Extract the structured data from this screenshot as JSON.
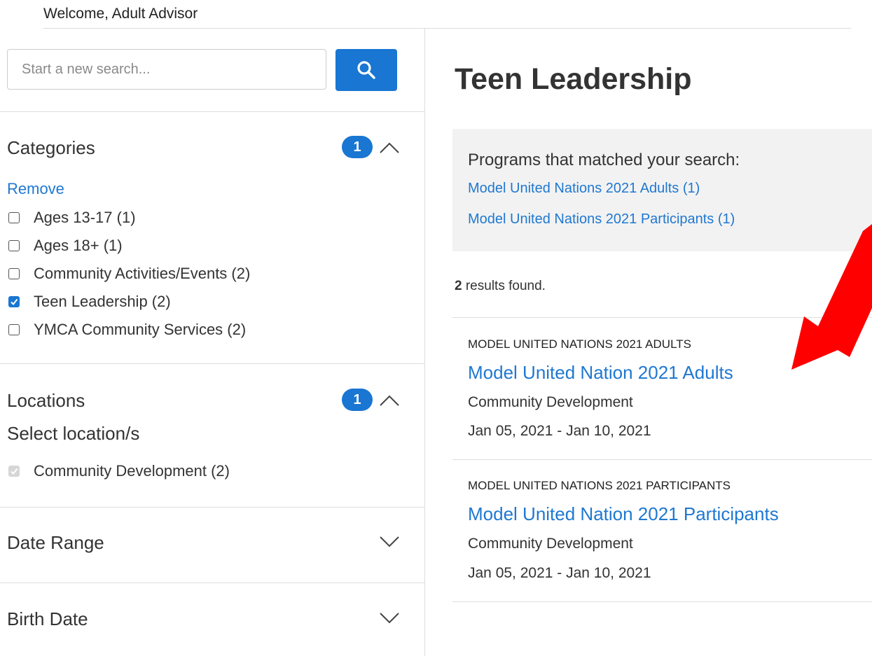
{
  "header": {
    "welcome": "Welcome, Adult Advisor"
  },
  "search": {
    "placeholder": "Start a new search..."
  },
  "filters": {
    "categories": {
      "title": "Categories",
      "badge": "1",
      "remove_label": "Remove",
      "items": [
        {
          "label": "Ages 13-17 (1)",
          "checked": false
        },
        {
          "label": "Ages 18+ (1)",
          "checked": false
        },
        {
          "label": "Community Activities/Events (2)",
          "checked": false
        },
        {
          "label": "Teen Leadership (2)",
          "checked": true
        },
        {
          "label": "YMCA Community Services (2)",
          "checked": false
        }
      ]
    },
    "locations": {
      "title": "Locations",
      "badge": "1",
      "subtitle": "Select location/s",
      "items": [
        {
          "label": "Community Development (2)",
          "checked": true,
          "disabled": true
        }
      ]
    },
    "date_range": {
      "title": "Date Range"
    },
    "birth_date": {
      "title": "Birth Date"
    }
  },
  "main": {
    "title": "Teen Leadership",
    "matched": {
      "title": "Programs that matched your search:",
      "links": [
        "Model United Nations 2021 Adults (1)",
        "Model United Nations 2021 Participants (1)"
      ]
    },
    "results_count": "2",
    "results_suffix": " results found.",
    "results": [
      {
        "eyebrow": "MODEL UNITED NATIONS 2021 ADULTS",
        "title": "Model United Nation 2021 Adults",
        "location": "Community Development",
        "dates": "Jan 05, 2021 - Jan 10, 2021"
      },
      {
        "eyebrow": "MODEL UNITED NATIONS 2021 PARTICIPANTS",
        "title": "Model United Nation 2021 Participants",
        "location": "Community Development",
        "dates": "Jan 05, 2021 - Jan 10, 2021"
      }
    ]
  },
  "colors": {
    "accent": "#1976d2",
    "link": "#1f78d1",
    "annotation_arrow": "#ff0000"
  },
  "icons": {
    "search": "search-icon",
    "collapse": "chevron-up-icon",
    "expand": "chevron-down-icon",
    "annotation": "red-arrow-icon"
  }
}
